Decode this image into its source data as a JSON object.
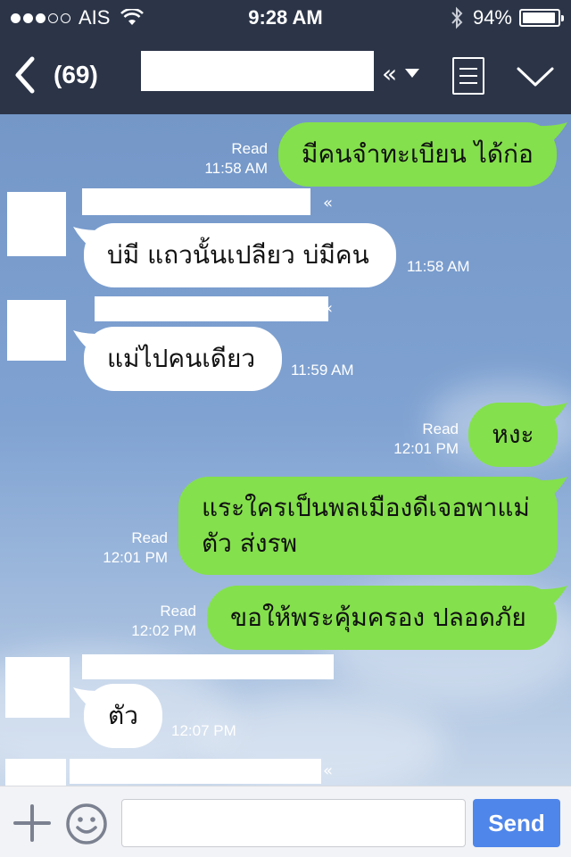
{
  "status_bar": {
    "carrier": "AIS",
    "signal_bars": 3,
    "signal_total": 5,
    "time": "9:28 AM",
    "battery_percent": "94%",
    "battery_level": 0.94
  },
  "nav": {
    "unread_count": "(69)",
    "icons": {
      "back": "chevron-left-icon",
      "dropdown": "double-chevron-left-icon",
      "menu": "list-menu-icon",
      "collapse": "chevron-down-icon"
    }
  },
  "messages": [
    {
      "direction": "out",
      "text": "มีคนจำทะเบียน ได้ก่อ",
      "status": "Read",
      "time": "11:58 AM"
    },
    {
      "direction": "in",
      "text": "บ่มี แถวนั้นเปลียว บ่มีคน",
      "time": "11:58 AM"
    },
    {
      "direction": "in",
      "text": "แม่ไปคนเดียว",
      "time": "11:59 AM"
    },
    {
      "direction": "out",
      "text": "หงะ",
      "status": "Read",
      "time": "12:01 PM"
    },
    {
      "direction": "out",
      "text_line1": "แระใครเป็นพลเมืองดีเจอพาแม่",
      "text_line2": "ตัว ส่งรพ",
      "status": "Read",
      "time": "12:01 PM"
    },
    {
      "direction": "out",
      "text": "ขอให้พระคุ้มครอง ปลอดภัย",
      "status": "Read",
      "time": "12:02 PM"
    },
    {
      "direction": "in",
      "text": "ตัว",
      "time": "12:07 PM"
    }
  ],
  "name_chevron": "«",
  "input": {
    "placeholder": "",
    "send_label": "Send"
  }
}
